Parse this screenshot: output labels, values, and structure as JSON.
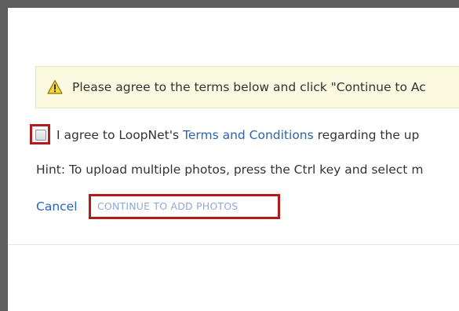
{
  "notice": {
    "icon": "warning-icon",
    "text": "Please agree to the terms below and click \"Continue to Ac"
  },
  "agreement": {
    "checked": false,
    "text_before": "I agree to LoopNet's ",
    "link_label": "Terms and Conditions",
    "text_after": " regarding the up"
  },
  "hint": {
    "text": "Hint: To upload multiple photos, press the Ctrl key and select m"
  },
  "actions": {
    "cancel_label": "Cancel",
    "continue_label": "CONTINUE TO ADD PHOTOS"
  },
  "colors": {
    "highlight_border": "#b31b1b",
    "link": "#2a63b7",
    "notice_bg": "#fbfae0",
    "backdrop": "#5e5e5e"
  }
}
